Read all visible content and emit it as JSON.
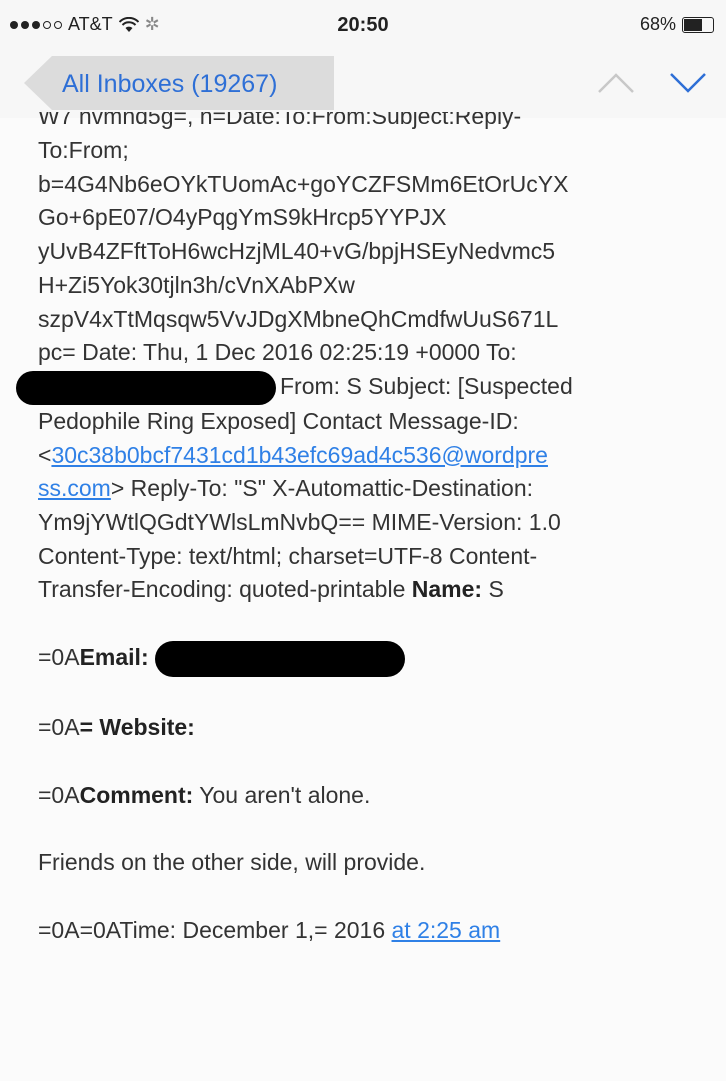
{
  "status_bar": {
    "carrier": "AT&T",
    "time": "20:50",
    "battery": "68%",
    "battery_level": 0.68
  },
  "nav": {
    "back_label": "All Inboxes (19267)",
    "prev_icon": "chevron-up-icon",
    "next_icon": "chevron-down-icon"
  },
  "email": {
    "cut_line": "W7 nvmnd5g=, h=Date:To:From:Subject:Reply-",
    "lines": [
      "To:From;",
      "b=4G4Nb6eOYkTUomAc+goYCZFSMm6EtOrUcYX",
      "Go+6pE07/O4yPqgYmS9kHrcp5YYPJX",
      "yUvB4ZFftToH6wcHzjML40+vG/bpjHSEyNedvmc5",
      "H+Zi5Yok30tjln3h/cVnXAbPXw",
      "szpV4xTtMqsqw5VvJDgXMbneQhCmdfwUuS671L",
      "pc= Date: Thu, 1 Dec 2016 02:25:19 +0000 To:"
    ],
    "from_after_redact": "From: S Subject: [Suspected",
    "subject_line": "Pedophile Ring Exposed] Contact Message-ID:",
    "msgid_prefix": "<",
    "msgid_link_1": "30c38b0bcf7431cd1b43efc69ad4c536@wordpre",
    "msgid_link_2": "ss.com",
    "msgid_suffix": "> Reply-To: \"S\" X-Automattic-Destination:",
    "dest_line": "Ym9jYWtlQGdtYWlsLmNvbQ== MIME-Version: 1.0",
    "content_type_line": "Content-Type: text/html; charset=UTF-8 Content-",
    "encoding_line_text": "Transfer-Encoding: quoted-printable ",
    "name_label": "Name:",
    "name_value": " S",
    "email_prefix": "=0A",
    "email_label": "Email:",
    "website_prefix": "=0A",
    "website_label": "= Website:",
    "comment_prefix": "=0A",
    "comment_label": "Comment:",
    "comment_value": " You aren't alone.",
    "friends_line": "Friends on the other side, will provide.",
    "time_prefix": "=0A=0ATime: December 1,= 2016 ",
    "time_link": "at 2:25 am"
  }
}
